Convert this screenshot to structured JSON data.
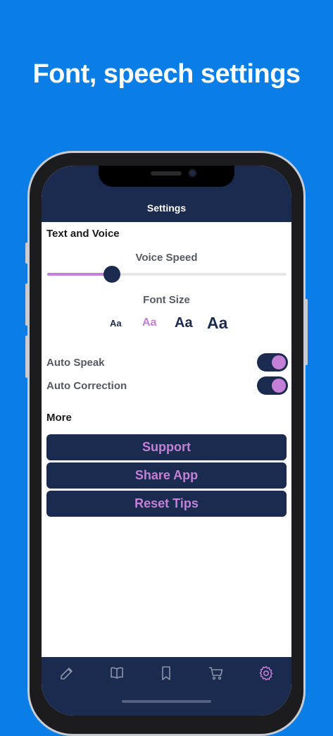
{
  "headline": "Font, speech settings",
  "nav": {
    "title": "Settings"
  },
  "text_and_voice": {
    "title": "Text and Voice",
    "voice_speed_label": "Voice Speed",
    "voice_speed_value": 0.27,
    "font_size_label": "Font Size",
    "font_options": [
      "Aa",
      "Aa",
      "Aa",
      "Aa"
    ],
    "font_selected_index": 1
  },
  "toggles": [
    {
      "label": "Auto Speak",
      "on": true
    },
    {
      "label": "Auto Correction",
      "on": true
    }
  ],
  "more": {
    "title": "More",
    "buttons": [
      "Support",
      "Share App",
      "Reset Tips"
    ]
  },
  "tabbar": {
    "icons": [
      "edit-icon",
      "book-icon",
      "bookmark-icon",
      "cart-icon",
      "gear-icon"
    ],
    "active": "gear-icon"
  },
  "colors": {
    "background": "#0a7de6",
    "navy": "#1b2a4f",
    "accent": "#c47fd6"
  }
}
